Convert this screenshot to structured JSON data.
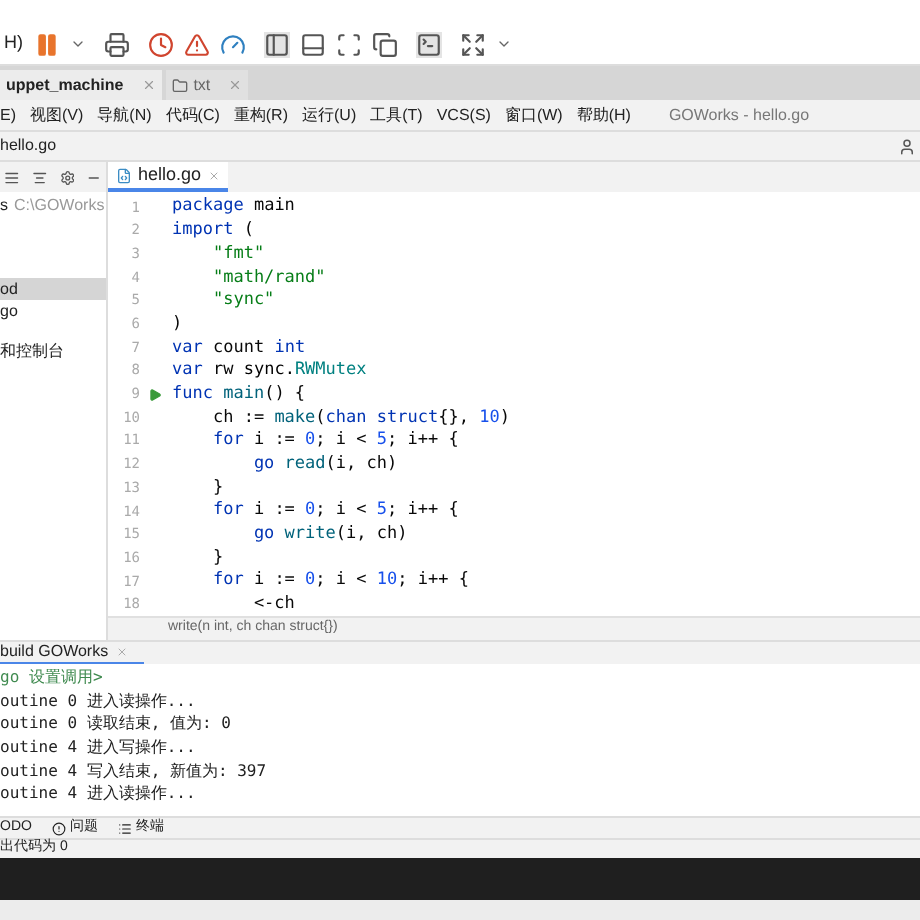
{
  "toolbar": {
    "menu_fragment": "H)"
  },
  "window_tabs": [
    {
      "label": "uppet_machine",
      "selected": true
    },
    {
      "label": "txt",
      "selected": false
    }
  ],
  "menu": [
    "E)",
    "视图(V)",
    "导航(N)",
    "代码(C)",
    "重构(R)",
    "运行(U)",
    "工具(T)",
    "VCS(S)",
    "窗口(W)",
    "帮助(H)"
  ],
  "window_title": "GOWorks - hello.go",
  "breadcrumb": "hello.go",
  "sidebar": {
    "items": [
      {
        "label": "s",
        "path": "C:\\GOWorks",
        "selected": false
      },
      {
        "label": "od",
        "selected": true
      },
      {
        "label": "go",
        "selected": false
      },
      {
        "label": "和控制台",
        "selected": false
      }
    ]
  },
  "editor_tabs": [
    {
      "label": "hello.go",
      "selected": true
    }
  ],
  "code_lines": [
    {
      "number": "1",
      "runnable": false,
      "segments": [
        {
          "text": "package ",
          "kind": "keyword"
        },
        {
          "text": "main",
          "kind": "plain"
        }
      ]
    },
    {
      "number": "2",
      "runnable": false,
      "segments": [
        {
          "text": "import ",
          "kind": "keyword"
        },
        {
          "text": "(",
          "kind": "plain"
        }
      ]
    },
    {
      "number": "3",
      "runnable": false,
      "segments": [
        {
          "text": "    \"fmt\"",
          "kind": "string"
        }
      ]
    },
    {
      "number": "4",
      "runnable": false,
      "segments": [
        {
          "text": "    \"math/rand\"",
          "kind": "string"
        }
      ]
    },
    {
      "number": "5",
      "runnable": false,
      "segments": [
        {
          "text": "    \"sync\"",
          "kind": "string"
        }
      ]
    },
    {
      "number": "6",
      "runnable": false,
      "segments": [
        {
          "text": ")",
          "kind": "plain"
        }
      ]
    },
    {
      "number": "7",
      "runnable": false,
      "segments": [
        {
          "text": "var ",
          "kind": "keyword"
        },
        {
          "text": "count ",
          "kind": "plain"
        },
        {
          "text": "int",
          "kind": "keyword"
        }
      ]
    },
    {
      "number": "8",
      "runnable": false,
      "segments": [
        {
          "text": "var ",
          "kind": "keyword"
        },
        {
          "text": "rw ",
          "kind": "plain"
        },
        {
          "text": "sync.",
          "kind": "package"
        },
        {
          "text": "RWMutex",
          "kind": "type"
        }
      ]
    },
    {
      "number": "9",
      "runnable": true,
      "segments": [
        {
          "text": "func ",
          "kind": "keyword"
        },
        {
          "text": "main",
          "kind": "function"
        },
        {
          "text": "() {",
          "kind": "plain"
        }
      ]
    },
    {
      "number": "10",
      "runnable": false,
      "segments": [
        {
          "text": "    ch := ",
          "kind": "plain"
        },
        {
          "text": "make",
          "kind": "function"
        },
        {
          "text": "(",
          "kind": "plain"
        },
        {
          "text": "chan struct",
          "kind": "keyword"
        },
        {
          "text": "{}, ",
          "kind": "plain"
        },
        {
          "text": "10",
          "kind": "number"
        },
        {
          "text": ")",
          "kind": "plain"
        }
      ]
    },
    {
      "number": "11",
      "runnable": false,
      "segments": [
        {
          "text": "    for ",
          "kind": "keyword"
        },
        {
          "text": "i := ",
          "kind": "plain"
        },
        {
          "text": "0",
          "kind": "number"
        },
        {
          "text": "; i < ",
          "kind": "plain"
        },
        {
          "text": "5",
          "kind": "number"
        },
        {
          "text": "; i++ {",
          "kind": "plain"
        }
      ]
    },
    {
      "number": "12",
      "runnable": false,
      "segments": [
        {
          "text": "        go ",
          "kind": "keyword"
        },
        {
          "text": "read",
          "kind": "function"
        },
        {
          "text": "(i, ch)",
          "kind": "plain"
        }
      ]
    },
    {
      "number": "13",
      "runnable": false,
      "segments": [
        {
          "text": "    }",
          "kind": "plain"
        }
      ]
    },
    {
      "number": "14",
      "runnable": false,
      "segments": [
        {
          "text": "    for ",
          "kind": "keyword"
        },
        {
          "text": "i := ",
          "kind": "plain"
        },
        {
          "text": "0",
          "kind": "number"
        },
        {
          "text": "; i < ",
          "kind": "plain"
        },
        {
          "text": "5",
          "kind": "number"
        },
        {
          "text": "; i++ {",
          "kind": "plain"
        }
      ]
    },
    {
      "number": "15",
      "runnable": false,
      "segments": [
        {
          "text": "        go ",
          "kind": "keyword"
        },
        {
          "text": "write",
          "kind": "function"
        },
        {
          "text": "(i, ch)",
          "kind": "plain"
        }
      ]
    },
    {
      "number": "16",
      "runnable": false,
      "segments": [
        {
          "text": "    }",
          "kind": "plain"
        }
      ]
    },
    {
      "number": "17",
      "runnable": false,
      "segments": [
        {
          "text": "    for ",
          "kind": "keyword"
        },
        {
          "text": "i := ",
          "kind": "plain"
        },
        {
          "text": "0",
          "kind": "number"
        },
        {
          "text": "; i < ",
          "kind": "plain"
        },
        {
          "text": "10",
          "kind": "number"
        },
        {
          "text": "; i++ {",
          "kind": "plain"
        }
      ]
    },
    {
      "number": "18",
      "runnable": false,
      "segments": [
        {
          "text": "        <-ch",
          "kind": "plain"
        }
      ]
    }
  ],
  "hint": "write(n int, ch chan struct{})",
  "run_tabs": [
    {
      "label": "build GOWorks",
      "selected": true
    }
  ],
  "console": [
    {
      "text": "go 设置调用>",
      "kind": "command"
    },
    {
      "text": "outine 0 进入读操作...",
      "kind": "output"
    },
    {
      "text": "outine 0 读取结束, 值为: 0",
      "kind": "output"
    },
    {
      "text": "outine 4 进入写操作...",
      "kind": "output"
    },
    {
      "text": "outine 4 写入结束, 新值为: 397",
      "kind": "output"
    },
    {
      "text": "outine 4 进入读操作...",
      "kind": "output"
    }
  ],
  "bottom_tabs": [
    "ODO",
    "问题",
    "终端"
  ],
  "status": "出代码为 0"
}
